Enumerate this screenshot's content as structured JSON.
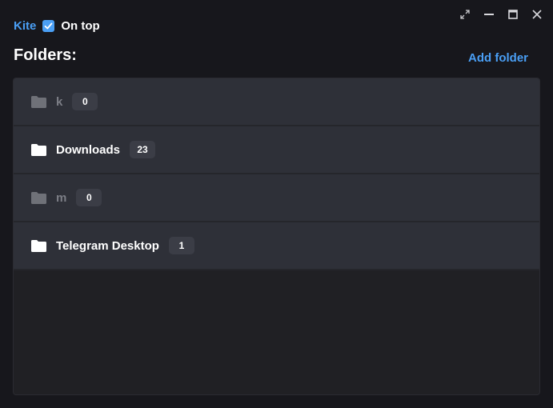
{
  "header": {
    "app_name": "Kite",
    "on_top_checked": true,
    "on_top_label": "On top"
  },
  "main": {
    "title": "Folders:",
    "add_folder_label": "Add folder"
  },
  "folders": [
    {
      "name": "k",
      "count": "0",
      "dimmed": true
    },
    {
      "name": "Downloads",
      "count": "23",
      "dimmed": false
    },
    {
      "name": "m",
      "count": "0",
      "dimmed": true
    },
    {
      "name": "Telegram Desktop",
      "count": "1",
      "dimmed": false
    }
  ],
  "window_controls": [
    "expand-icon",
    "minimize-icon",
    "maximize-icon",
    "close-icon"
  ],
  "colors": {
    "accent": "#4a9ff5",
    "background": "#17171c",
    "row": "#2e3038",
    "panel": "#202024",
    "dim_text": "#7c7e86"
  }
}
